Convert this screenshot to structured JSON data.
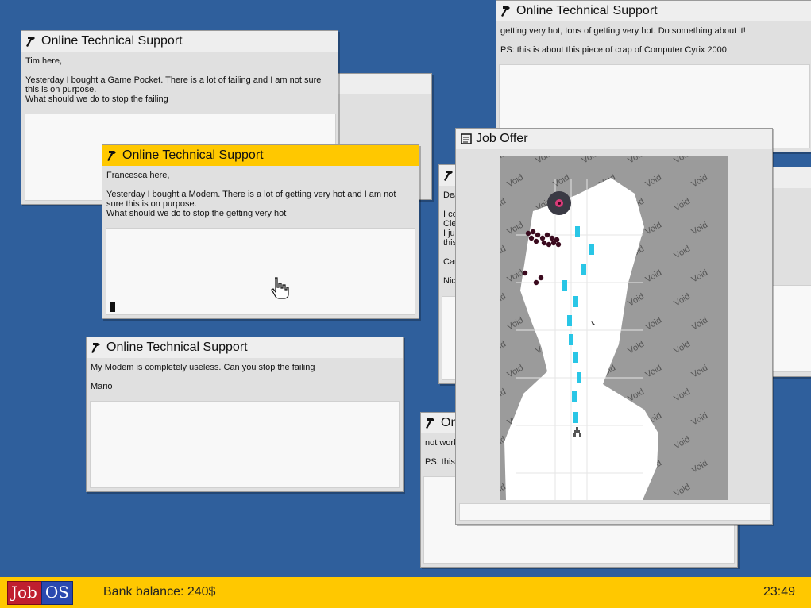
{
  "windows": {
    "w1": {
      "title": "Online Technical Support",
      "message": "getting very hot, tons of getting very hot. Do something about it!\n\nPS: this is about this piece of crap of Computer Cyrix 2000"
    },
    "w2": {
      "title": "Online Technical Support",
      "message": "Tim here,\n\nYesterday I bought a Game Pocket. There is a lot of failing and I am not sure this is on purpose.\nWhat should we do to stop the failing"
    },
    "w3": {
      "title": "Online Technical Support",
      "message": "Francesca here,\n\nYesterday I bought a Modem. There is a lot of getting very hot and I am not sure this is on purpose.\nWhat should we do to stop the getting very hot"
    },
    "w4": {
      "title": "Online Technical Support",
      "message": "My Modem is completely useless. Can you stop the failing\n\nMario"
    },
    "w5": {
      "title": "On",
      "message": "not work\n\nPS: this"
    },
    "w6": {
      "title": "",
      "message": "Dea\n\nI co\nCle\nI ju\nthis\n\nCan\n\nNic"
    },
    "job_offer": {
      "title": "Job Offer",
      "watermark": "Void"
    }
  },
  "taskbar": {
    "logo_job": "Job",
    "logo_os": "OS",
    "bank_balance": "Bank balance: 240$",
    "clock": "23:49"
  },
  "colors": {
    "desktop": "#2f5f9c",
    "active_title": "#ffc800",
    "taskbar": "#ffc800",
    "enemy": "#3a0a1e",
    "bullet": "#29c6e6"
  },
  "icons": {
    "support": "hammer-icon",
    "job_offer": "document-icon"
  }
}
